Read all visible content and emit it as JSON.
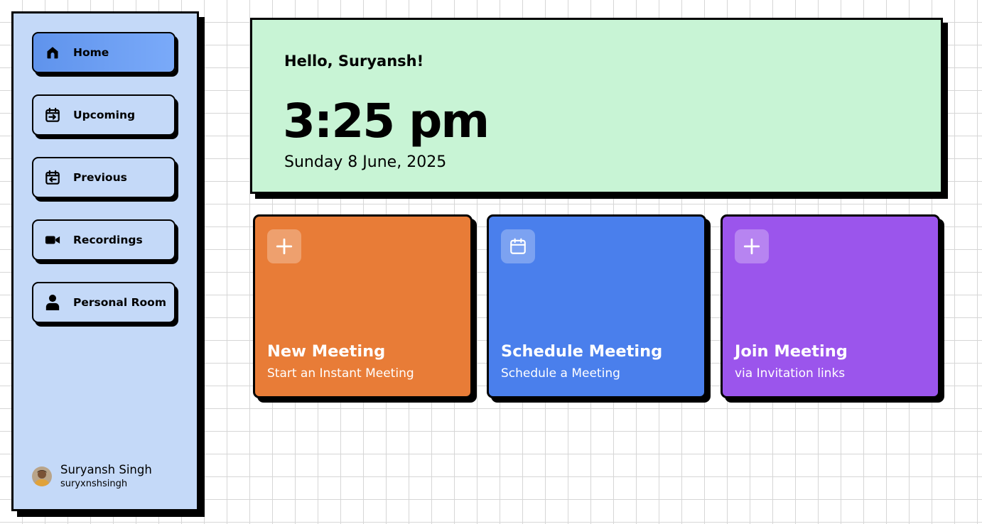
{
  "sidebar": {
    "items": [
      {
        "label": "Home",
        "icon": "home-icon",
        "active": true
      },
      {
        "label": "Upcoming",
        "icon": "calendar-upcoming-icon",
        "active": false
      },
      {
        "label": "Previous",
        "icon": "calendar-previous-icon",
        "active": false
      },
      {
        "label": "Recordings",
        "icon": "video-camera-icon",
        "active": false
      },
      {
        "label": "Personal Room",
        "icon": "user-icon",
        "active": false
      }
    ],
    "user": {
      "name": "Suryansh Singh",
      "handle": "suryxnshsingh"
    }
  },
  "hero": {
    "greeting": "Hello, Suryansh!",
    "time": "3:25 pm",
    "date": "Sunday 8 June, 2025"
  },
  "cards": [
    {
      "title": "New Meeting",
      "subtitle": "Start an Instant Meeting",
      "icon": "plus-icon",
      "color": "#e87c37"
    },
    {
      "title": "Schedule Meeting",
      "subtitle": "Schedule a Meeting",
      "icon": "calendar-icon",
      "color": "#4a7fec"
    },
    {
      "title": "Join Meeting",
      "subtitle": "via Invitation links",
      "icon": "plus-icon",
      "color": "#9b55ec"
    }
  ],
  "colors": {
    "sidebar_bg": "#c4d9f8",
    "active_nav": "#6b9ef3",
    "hero_bg": "#c8f4d5"
  }
}
